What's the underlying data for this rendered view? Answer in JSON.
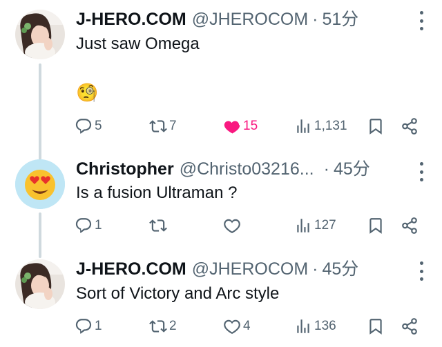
{
  "tweets": [
    {
      "name": "J-HERO.COM",
      "handle": "@JHEROCOM",
      "separator": "·",
      "time": "51分",
      "text": "Just saw Omega",
      "emoji": "🧐",
      "replies": "5",
      "retweets": "7",
      "likes": "15",
      "liked": true,
      "views": "1,131"
    },
    {
      "name": "Christopher",
      "handle": "@Christo03216...",
      "separator": "·",
      "time": "45分",
      "text": "Is a fusion Ultraman ?",
      "replies": "1",
      "retweets": "",
      "likes": "",
      "liked": false,
      "views": "127"
    },
    {
      "name": "J-HERO.COM",
      "handle": "@JHEROCOM",
      "separator": "·",
      "time": "45分",
      "text": "Sort of Victory and Arc style",
      "replies": "1",
      "retweets": "2",
      "likes": "4",
      "liked": false,
      "views": "136"
    }
  ],
  "colors": {
    "text": "#0f1419",
    "secondary": "#536471",
    "like_active": "#f91880",
    "thread_line": "#cfd9de"
  },
  "icons": [
    "reply-icon",
    "retweet-icon",
    "like-icon",
    "views-icon",
    "bookmark-icon",
    "share-icon",
    "more-icon"
  ]
}
